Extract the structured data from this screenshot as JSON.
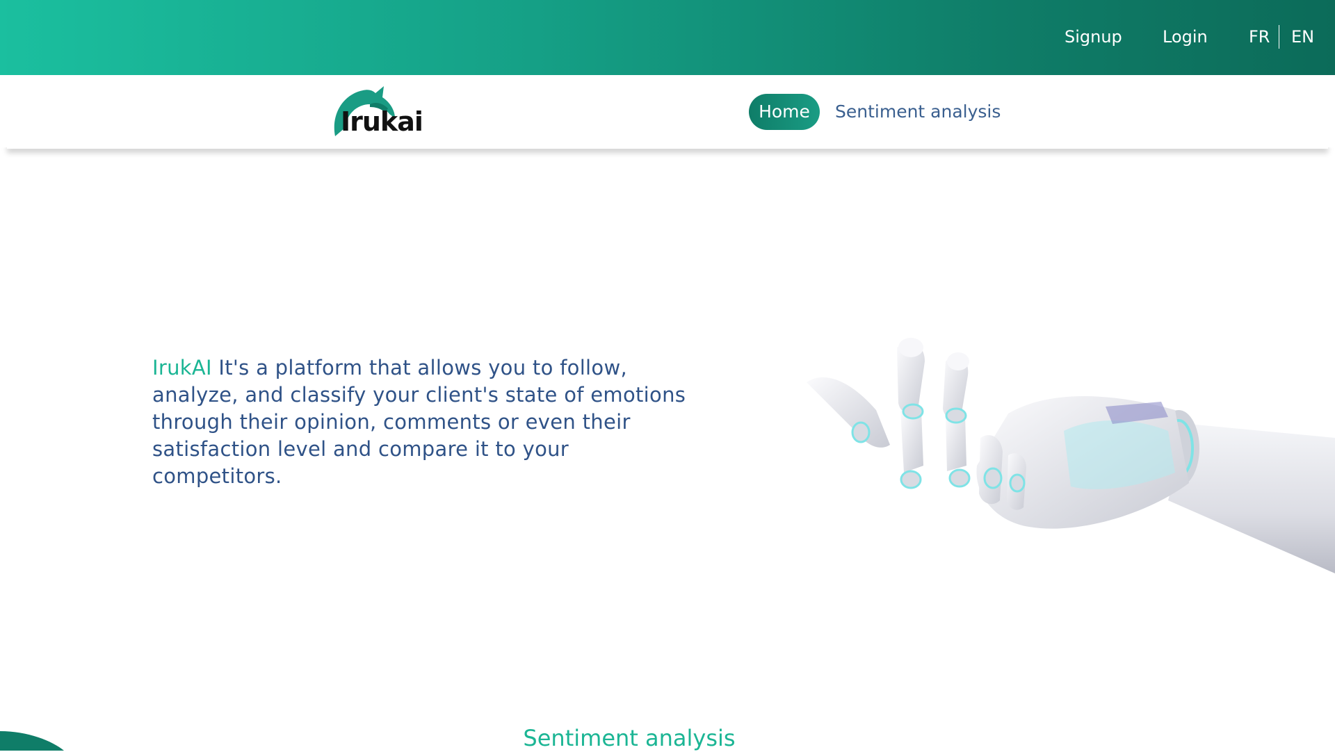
{
  "topbar": {
    "signup_label": "Signup",
    "login_label": "Login",
    "lang_fr": "FR",
    "lang_en": "EN"
  },
  "brand": {
    "logo_text": "Irukai"
  },
  "nav": {
    "items": [
      {
        "label": "Home",
        "active": true
      },
      {
        "label": "Sentiment analysis",
        "active": false
      }
    ]
  },
  "hero": {
    "brand_name": "IrukAI",
    "description": "It's a platform that allows you to follow, analyze, and classify your client's state of emotions through their opinion, comments or even their satisfaction level and compare it to your competitors."
  },
  "section": {
    "title": "Sentiment analysis"
  },
  "colors": {
    "accent": "#1bb594",
    "accent_dark": "#0f7d68",
    "text_blue": "#2f5287"
  },
  "icons": {
    "logo": "dolphin-icon",
    "hero_image": "robot-hand-icon"
  }
}
